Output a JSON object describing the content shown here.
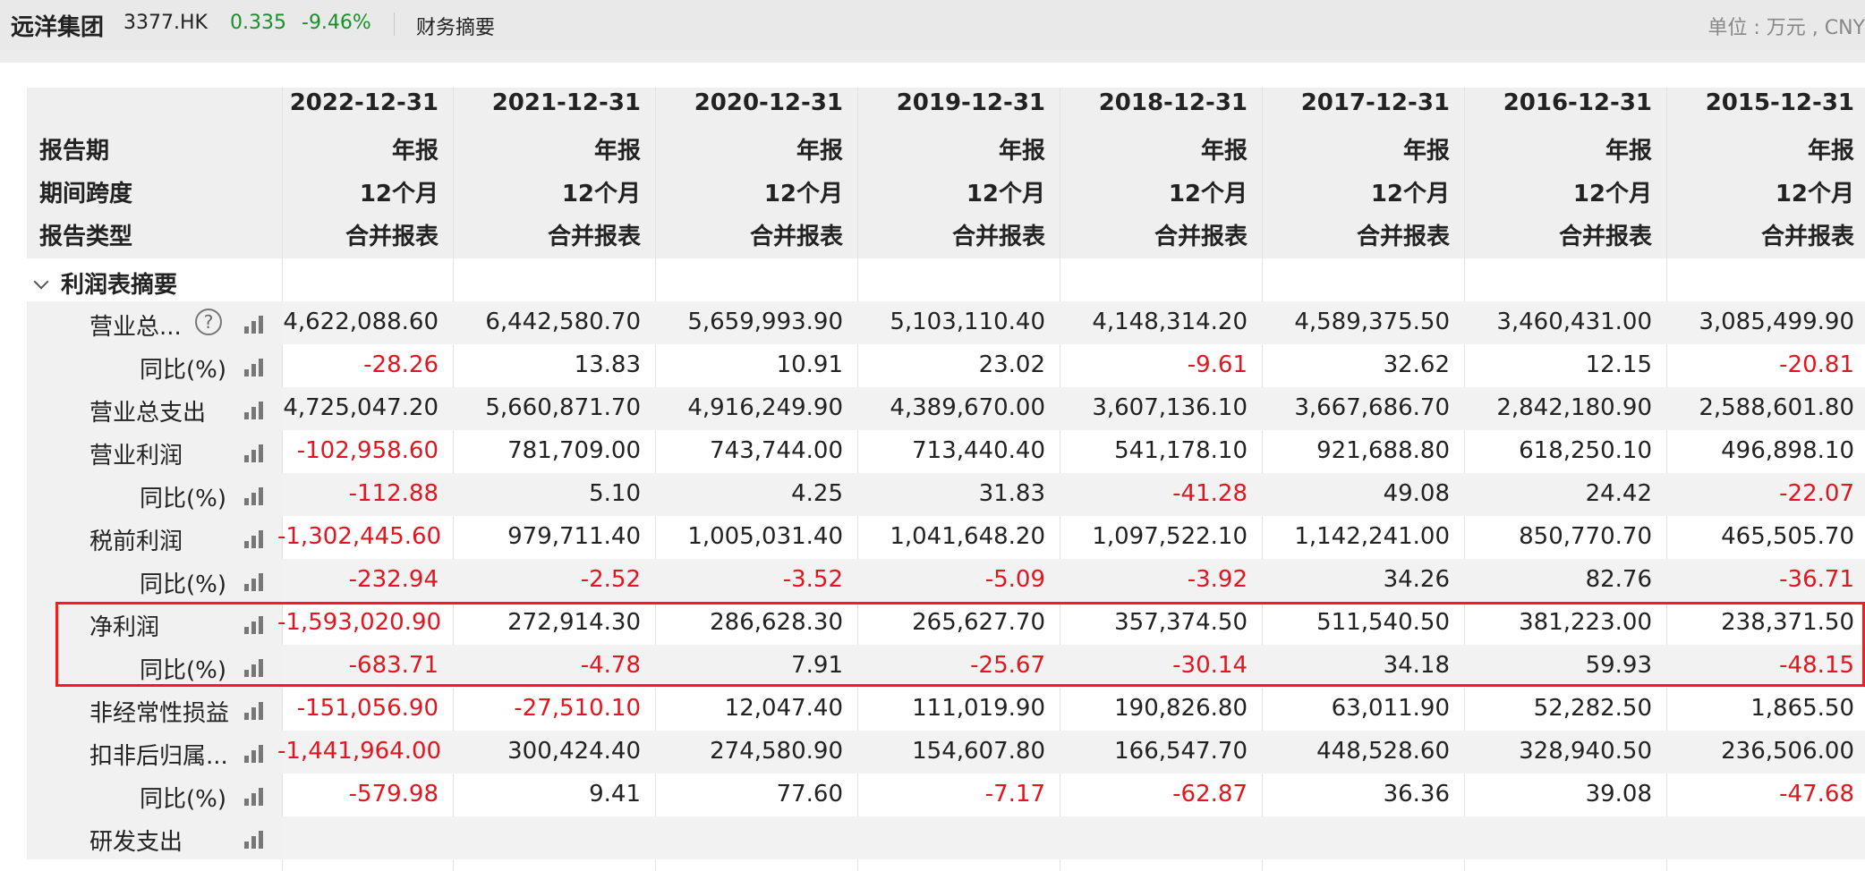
{
  "topbar": {
    "company": "远洋集团",
    "code": "3377.HK",
    "price": "0.335",
    "change": "-9.46%",
    "tab": "财务摘要",
    "unit": "单位 : 万元 , CNY"
  },
  "header": {
    "labels": [
      "报告期",
      "期间跨度",
      "报告类型"
    ],
    "dates": [
      "2022-12-31",
      "2021-12-31",
      "2020-12-31",
      "2019-12-31",
      "2018-12-31",
      "2017-12-31",
      "2016-12-31",
      "2015-12-31"
    ],
    "period": [
      "年报",
      "年报",
      "年报",
      "年报",
      "年报",
      "年报",
      "年报",
      "年报"
    ],
    "span": [
      "12个月",
      "12个月",
      "12个月",
      "12个月",
      "12个月",
      "12个月",
      "12个月",
      "12个月"
    ],
    "type": [
      "合并报表",
      "合并报表",
      "合并报表",
      "合并报表",
      "合并报表",
      "合并报表",
      "合并报表",
      "合并报表"
    ]
  },
  "section": {
    "title": "利润表摘要"
  },
  "rows": [
    {
      "label": "营业总...",
      "level": 1,
      "help": true,
      "values": [
        "4,622,088.60",
        "6,442,580.70",
        "5,659,993.90",
        "5,103,110.40",
        "4,148,314.20",
        "4,589,375.50",
        "3,460,431.00",
        "3,085,499.90"
      ]
    },
    {
      "label": "同比(%)",
      "level": 2,
      "values": [
        "-28.26",
        "13.83",
        "10.91",
        "23.02",
        "-9.61",
        "32.62",
        "12.15",
        "-20.81"
      ]
    },
    {
      "label": "营业总支出",
      "level": 1,
      "values": [
        "4,725,047.20",
        "5,660,871.70",
        "4,916,249.90",
        "4,389,670.00",
        "3,607,136.10",
        "3,667,686.70",
        "2,842,180.90",
        "2,588,601.80"
      ]
    },
    {
      "label": "营业利润",
      "level": 1,
      "values": [
        "-102,958.60",
        "781,709.00",
        "743,744.00",
        "713,440.40",
        "541,178.10",
        "921,688.80",
        "618,250.10",
        "496,898.10"
      ]
    },
    {
      "label": "同比(%)",
      "level": 2,
      "values": [
        "-112.88",
        "5.10",
        "4.25",
        "31.83",
        "-41.28",
        "49.08",
        "24.42",
        "-22.07"
      ]
    },
    {
      "label": "税前利润",
      "level": 1,
      "values": [
        "-1,302,445.60",
        "979,711.40",
        "1,005,031.40",
        "1,041,648.20",
        "1,097,522.10",
        "1,142,241.00",
        "850,770.70",
        "465,505.70"
      ]
    },
    {
      "label": "同比(%)",
      "level": 2,
      "values": [
        "-232.94",
        "-2.52",
        "-3.52",
        "-5.09",
        "-3.92",
        "34.26",
        "82.76",
        "-36.71"
      ]
    },
    {
      "label": "净利润",
      "level": 1,
      "values": [
        "-1,593,020.90",
        "272,914.30",
        "286,628.30",
        "265,627.70",
        "357,374.50",
        "511,540.50",
        "381,223.00",
        "238,371.50"
      ]
    },
    {
      "label": "同比(%)",
      "level": 2,
      "values": [
        "-683.71",
        "-4.78",
        "7.91",
        "-25.67",
        "-30.14",
        "34.18",
        "59.93",
        "-48.15"
      ]
    },
    {
      "label": "非经常性损益",
      "level": 1,
      "values": [
        "-151,056.90",
        "-27,510.10",
        "12,047.40",
        "111,019.90",
        "190,826.80",
        "63,011.90",
        "52,282.50",
        "1,865.50"
      ]
    },
    {
      "label": "扣非后归属...",
      "level": 1,
      "values": [
        "-1,441,964.00",
        "300,424.40",
        "274,580.90",
        "154,607.80",
        "166,547.70",
        "448,528.60",
        "328,940.50",
        "236,506.00"
      ]
    },
    {
      "label": "同比(%)",
      "level": 2,
      "values": [
        "-579.98",
        "9.41",
        "77.60",
        "-7.17",
        "-62.87",
        "36.36",
        "39.08",
        "-47.68"
      ]
    },
    {
      "label": "研发支出",
      "level": 1,
      "values": [
        "",
        "",
        "",
        "",
        "",
        "",
        "",
        ""
      ]
    }
  ],
  "colors": {
    "negative": "#e0171f",
    "positive_quote": "#1a8f2c",
    "highlight": "#ff1a1a"
  }
}
